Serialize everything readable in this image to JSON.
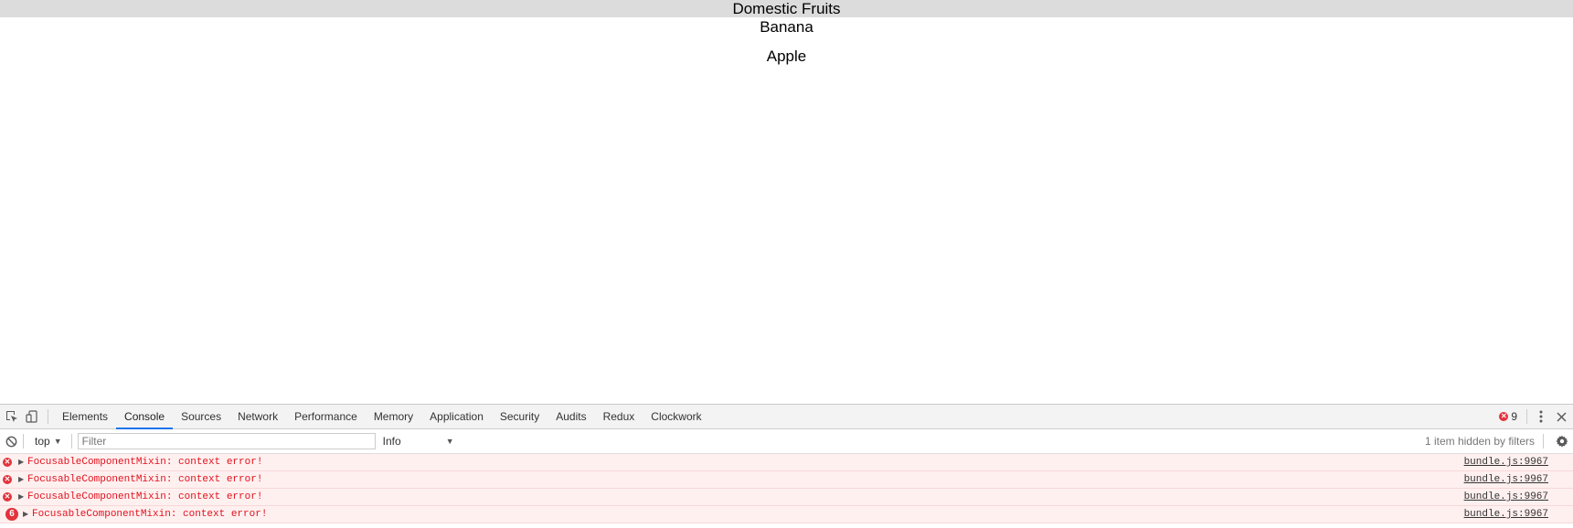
{
  "app": {
    "header_title": "Domestic Fruits",
    "fruits": [
      "Banana",
      "Apple"
    ]
  },
  "devtools": {
    "tabs": [
      {
        "label": "Elements",
        "active": false
      },
      {
        "label": "Console",
        "active": true
      },
      {
        "label": "Sources",
        "active": false
      },
      {
        "label": "Network",
        "active": false
      },
      {
        "label": "Performance",
        "active": false
      },
      {
        "label": "Memory",
        "active": false
      },
      {
        "label": "Application",
        "active": false
      },
      {
        "label": "Security",
        "active": false
      },
      {
        "label": "Audits",
        "active": false
      },
      {
        "label": "Redux",
        "active": false
      },
      {
        "label": "Clockwork",
        "active": false
      }
    ],
    "error_count": "9",
    "console": {
      "context": "top",
      "filter_placeholder": "Filter",
      "filter_value": "",
      "level": "Info",
      "hidden_info": "1 item hidden by filters"
    },
    "messages": [
      {
        "text": "FocusableComponentMixin: context error!",
        "source": "bundle.js:9967",
        "count": ""
      },
      {
        "text": "FocusableComponentMixin: context error!",
        "source": "bundle.js:9967",
        "count": ""
      },
      {
        "text": "FocusableComponentMixin: context error!",
        "source": "bundle.js:9967",
        "count": ""
      },
      {
        "text": "FocusableComponentMixin: context error!",
        "source": "bundle.js:9967",
        "count": "6"
      }
    ],
    "colors": {
      "accent": "#1a73e8",
      "error": "#e2323b",
      "error_text": "#e0121c",
      "error_bg": "#fff0f0"
    },
    "icons": [
      "inspect-element-icon",
      "device-toolbar-icon",
      "more-vertical-icon",
      "close-icon",
      "clear-console-icon",
      "settings-gear-icon"
    ]
  }
}
